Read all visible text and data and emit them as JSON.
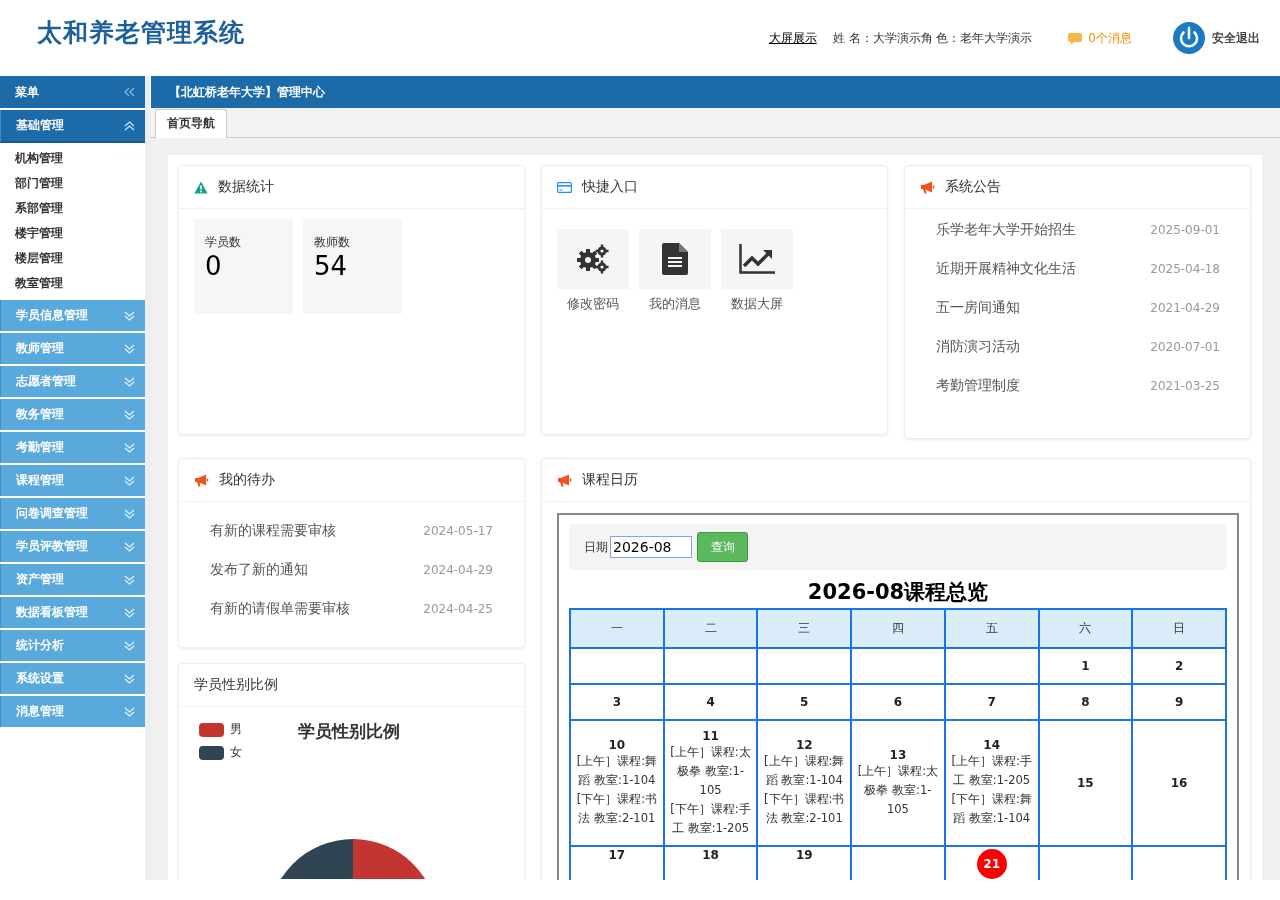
{
  "header": {
    "title": "太和养老管理系统",
    "big_screen_link": "大屏展示",
    "user_info": "姓 名：大学演示角 色：老年大学演示",
    "messages": "0个消息",
    "logout": "安全退出"
  },
  "sidebar": {
    "title": "菜单",
    "groups": [
      {
        "label": "基础管理",
        "expanded": true,
        "children": [
          {
            "label": "机构管理"
          },
          {
            "label": "部门管理"
          },
          {
            "label": "系部管理"
          },
          {
            "label": "楼宇管理"
          },
          {
            "label": "楼层管理"
          },
          {
            "label": "教室管理"
          }
        ]
      },
      {
        "label": "学员信息管理",
        "expanded": false
      },
      {
        "label": "教师管理",
        "expanded": false
      },
      {
        "label": "志愿者管理",
        "expanded": false
      },
      {
        "label": "教务管理",
        "expanded": false
      },
      {
        "label": "考勤管理",
        "expanded": false
      },
      {
        "label": "课程管理",
        "expanded": false
      },
      {
        "label": "问卷调查管理",
        "expanded": false
      },
      {
        "label": "学员评教管理",
        "expanded": false
      },
      {
        "label": "资产管理",
        "expanded": false
      },
      {
        "label": "数据看板管理",
        "expanded": false
      },
      {
        "label": "统计分析",
        "expanded": false
      },
      {
        "label": "系统设置",
        "expanded": false
      },
      {
        "label": "消息管理",
        "expanded": false
      }
    ]
  },
  "main": {
    "title": "【北虹桥老年大学】管理中心",
    "tabs": [
      {
        "label": "首页导航",
        "selected": true
      }
    ]
  },
  "stats": {
    "title": "数据统计",
    "items": [
      {
        "label": "学员数",
        "value": "0"
      },
      {
        "label": "教师数",
        "value": "54"
      }
    ]
  },
  "shortcuts": {
    "title": "快捷入口",
    "items": [
      {
        "label": "修改密码",
        "kind": "gears"
      },
      {
        "label": "我的消息",
        "kind": "document"
      },
      {
        "label": "数据大屏",
        "kind": "chart"
      }
    ]
  },
  "notices": {
    "title": "系统公告",
    "items": [
      {
        "text": "乐学老年大学开始招生",
        "date": "2025-09-01"
      },
      {
        "text": "近期开展精神文化生活",
        "date": "2025-04-18"
      },
      {
        "text": "五一房间通知",
        "date": "2021-04-29"
      },
      {
        "text": "消防演习活动",
        "date": "2020-07-01"
      },
      {
        "text": "考勤管理制度",
        "date": "2021-03-25"
      }
    ]
  },
  "todos": {
    "title": "我的待办",
    "items": [
      {
        "text": "有新的课程需要审核",
        "date": "2024-05-17"
      },
      {
        "text": "发布了新的通知",
        "date": "2024-04-29"
      },
      {
        "text": "有新的请假单需要审核",
        "date": "2024-04-25"
      }
    ]
  },
  "gender": {
    "title": "学员性别比例",
    "chart_title": "学员性别比例",
    "legend": [
      {
        "label": "男",
        "color": "#c23531"
      },
      {
        "label": "女",
        "color": "#2f4554"
      }
    ]
  },
  "calendar": {
    "title": "课程日历",
    "date_label": "日期",
    "date_value": "2026-08",
    "query_button": "查询",
    "heading": "2026-08课程总览",
    "weekdays": [
      "一",
      "二",
      "三",
      "四",
      "五",
      "六",
      "日"
    ],
    "weeks": [
      [
        {
          "kind": "empty"
        },
        {
          "kind": "empty"
        },
        {
          "kind": "empty"
        },
        {
          "kind": "empty"
        },
        {
          "kind": "empty"
        },
        {
          "day": "1"
        },
        {
          "day": "2"
        }
      ],
      [
        {
          "day": "3"
        },
        {
          "day": "4"
        },
        {
          "day": "5"
        },
        {
          "day": "6"
        },
        {
          "day": "7"
        },
        {
          "day": "8"
        },
        {
          "day": "9"
        }
      ],
      [
        {
          "day": "10",
          "lines": [
            "[上午］课程:舞蹈 教室:1-104",
            "[下午］课程:书法 教室:2-101"
          ]
        },
        {
          "day": "11",
          "lines": [
            "[上午］课程:太极拳 教室:1-105",
            "[下午］课程:手工 教室:1-205"
          ]
        },
        {
          "day": "12",
          "lines": [
            "[上午］课程:舞蹈 教室:1-104",
            "[下午］课程:书法 教室:2-101"
          ]
        },
        {
          "day": "13",
          "lines": [
            "[上午］课程:太极拳 教室:1-105"
          ]
        },
        {
          "day": "14",
          "lines": [
            "[上午］课程:手工 教室:1-205",
            "[下午］课程:舞蹈 教室:1-104"
          ]
        },
        {
          "day": "15"
        },
        {
          "day": "16"
        }
      ],
      [
        {
          "day": "17"
        },
        {
          "day": "18"
        },
        {
          "day": "19"
        },
        {
          "kind": "empty"
        },
        {
          "day": "21",
          "today": true
        },
        {
          "kind": "empty"
        },
        {
          "kind": "empty"
        }
      ]
    ]
  }
}
